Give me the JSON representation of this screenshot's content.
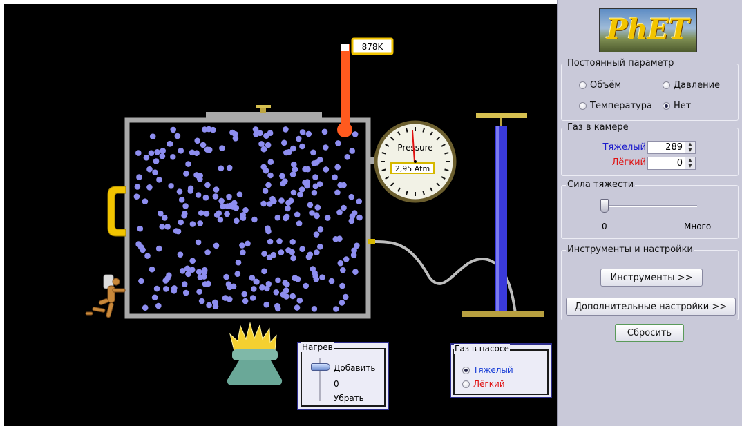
{
  "simulation": {
    "thermometer_readout": "878K",
    "gauge_label": "Pressure",
    "gauge_readout": "2,95 Atm"
  },
  "heat_panel": {
    "title": "Нагрев",
    "add_label": "Добавить",
    "zero_label": "0",
    "remove_label": "Убрать"
  },
  "pump_gas_panel": {
    "title": "Газ в насосе",
    "options": [
      {
        "label": "Тяжелый",
        "selected": true,
        "color": "#1a3fd6"
      },
      {
        "label": "Лёгкий",
        "selected": false,
        "color": "#e01010"
      }
    ]
  },
  "sidebar": {
    "logo_text": "PhET",
    "constant_param": {
      "title": "Постоянный параметр",
      "options": [
        {
          "label": "Объём",
          "selected": false
        },
        {
          "label": "Давление",
          "selected": false
        },
        {
          "label": "Температура",
          "selected": false
        },
        {
          "label": "Нет",
          "selected": true
        }
      ]
    },
    "chamber_gas": {
      "title": "Газ в камере",
      "heavy_label": "Тяжелый",
      "heavy_value": "289",
      "light_label": "Лёгкий",
      "light_value": "0",
      "heavy_color": "#1a1acc",
      "light_color": "#e01010"
    },
    "gravity": {
      "title": "Сила тяжести",
      "min_label": "0",
      "max_label": "Много",
      "level": 0
    },
    "tools": {
      "title": "Инструменты и настройки",
      "tools_button": "Инструменты >>",
      "advanced_button": "Дополнительные настройки >>"
    },
    "reset_button": "Сбросить"
  },
  "colors": {
    "particle": "#8e8ef0",
    "thermometer": "#ff5a1e",
    "pump": "#3a3adc",
    "box_wall": "#a9a9a9",
    "handle": "#f2c400"
  }
}
